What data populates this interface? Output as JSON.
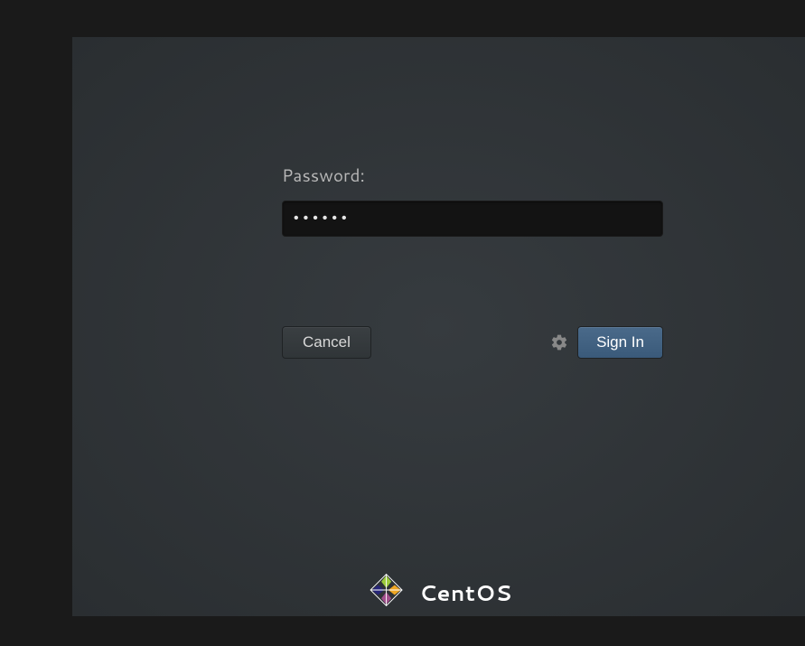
{
  "form": {
    "password_label": "Password:",
    "password_value": "••••••",
    "cancel_label": "Cancel",
    "signin_label": "Sign In"
  },
  "branding": {
    "os_name": "CentOS"
  }
}
